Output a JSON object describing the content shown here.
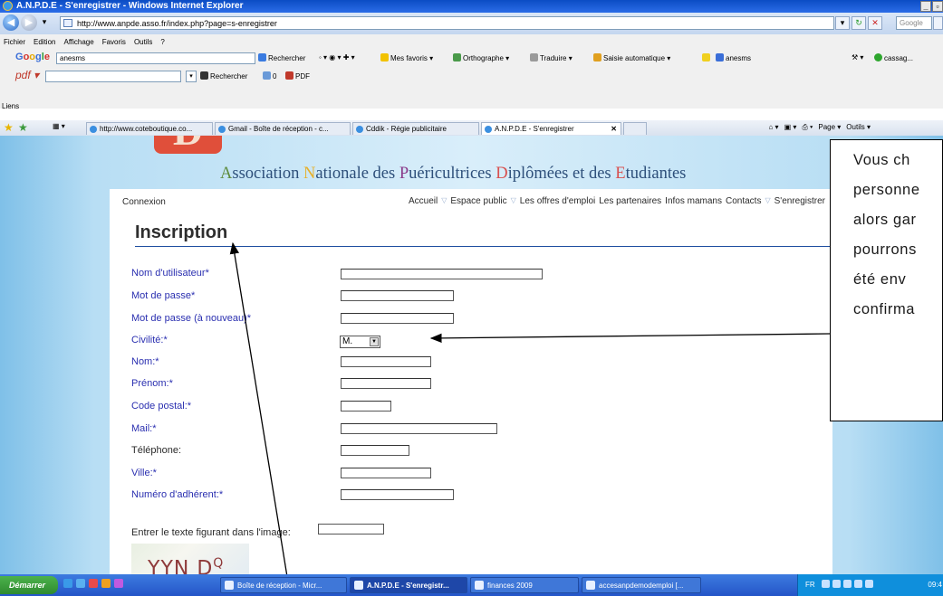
{
  "window": {
    "title": "A.N.P.D.E - S'enregistrer - Windows Internet Explorer"
  },
  "addressbar": {
    "url": "http://www.anpde.asso.fr/index.php?page=s-enregistrer",
    "search_placeholder": "Google"
  },
  "menu": {
    "items": [
      "Fichier",
      "Edition",
      "Affichage",
      "Favoris",
      "Outils",
      "?"
    ]
  },
  "google_toolbar": {
    "query": "anesms",
    "search_label": "Rechercher",
    "favoris": "Mes favoris",
    "orthographe": "Orthographe",
    "traduire": "Traduire",
    "saisie": "Saisie automatique",
    "anesms": "anesms",
    "account": "cassag..."
  },
  "pdf_toolbar": {
    "search_label": "Rechercher",
    "count": "0",
    "pdf_label": "PDF"
  },
  "links_bar": {
    "label": "Liens"
  },
  "tabs": [
    {
      "label": "http://www.coteboutique.co..."
    },
    {
      "label": "Gmail - Boîte de réception - c..."
    },
    {
      "label": "Cddik - Régie publicitaire"
    },
    {
      "label": "A.N.P.D.E - S'enregistrer"
    }
  ],
  "right_tools": {
    "page": "Page",
    "outils": "Outils"
  },
  "site": {
    "logo_letter": "D",
    "title_parts": [
      {
        "first": "A",
        "rest": "ssociation "
      },
      {
        "first": "N",
        "rest": "ationale des "
      },
      {
        "first": "P",
        "rest": "uéricultrices "
      },
      {
        "first": "D",
        "rest": "iplômées et des "
      },
      {
        "first": "E",
        "rest": "tudiantes"
      }
    ],
    "connexion": "Connexion",
    "nav": [
      "Accueil",
      "Espace public",
      "Les offres d'emploi",
      "Les partenaires",
      "Infos mamans",
      "Contacts",
      "S'enregistrer"
    ]
  },
  "form": {
    "title": "Inscription",
    "fields": [
      {
        "label": "Nom d'utilisateur*"
      },
      {
        "label": "Mot de passe*"
      },
      {
        "label": "Mot de passe (à nouveau)*"
      },
      {
        "label": "Civilité:*",
        "value": "M."
      },
      {
        "label": "Nom:*"
      },
      {
        "label": "Prénom:*"
      },
      {
        "label": "Code postal:*"
      },
      {
        "label": "Mail:*"
      },
      {
        "label": "Téléphone:"
      },
      {
        "label": "Ville:*"
      },
      {
        "label": "Numéro d'adhérent:*"
      }
    ],
    "captcha_label": "Entrer le texte figurant dans l'image:",
    "captcha_text": "YYN D",
    "captcha_small": "Q"
  },
  "callout": {
    "lines": [
      "Vous ch",
      "personne",
      "alors gar",
      "pourrons",
      "été env",
      "confirma"
    ]
  },
  "taskbar": {
    "start": "Démarrer",
    "tasks": [
      {
        "label": "Boîte de réception - Micr..."
      },
      {
        "label": "A.N.P.D.E - S'enregistr..."
      },
      {
        "label": "finances 2009"
      },
      {
        "label": "accesanpdemodemploi [..."
      }
    ],
    "lang": "FR",
    "clock": "09:4"
  }
}
